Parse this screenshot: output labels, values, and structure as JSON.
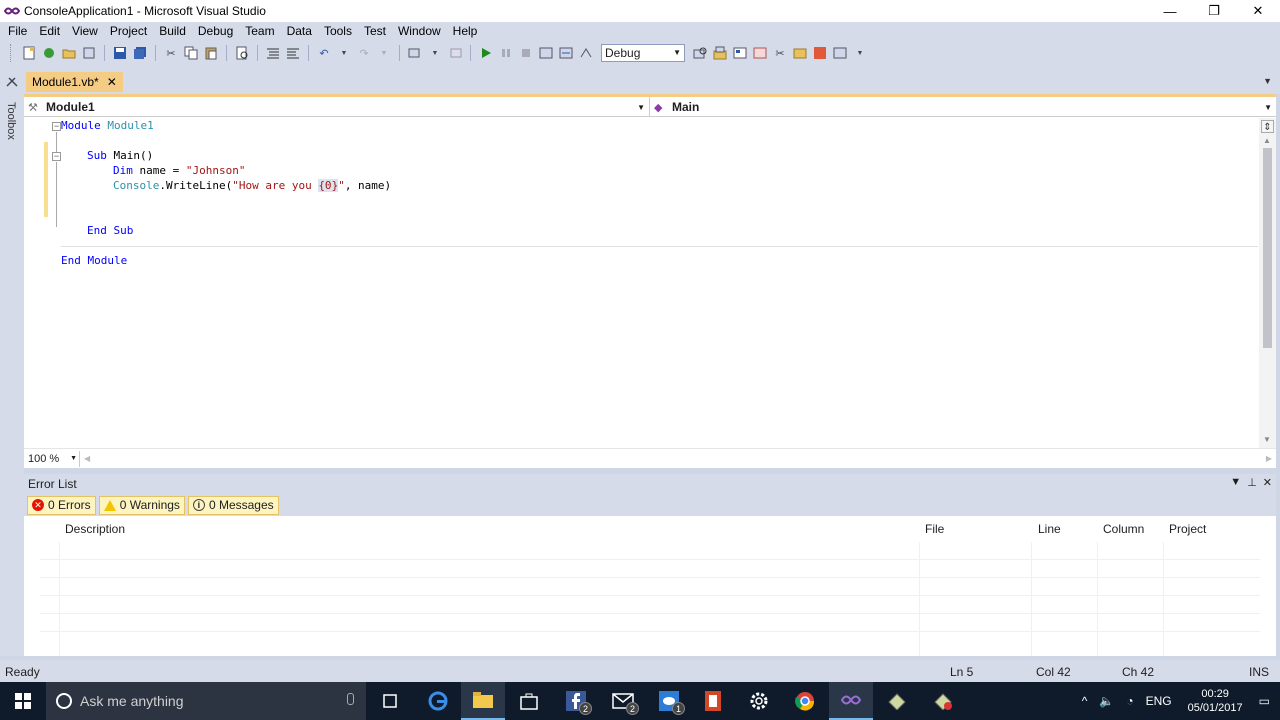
{
  "window": {
    "title": "ConsoleApplication1 - Microsoft Visual Studio",
    "minimize": "—",
    "restore": "❐",
    "close": "✕"
  },
  "menu": [
    "File",
    "Edit",
    "View",
    "Project",
    "Build",
    "Debug",
    "Team",
    "Data",
    "Tools",
    "Test",
    "Window",
    "Help"
  ],
  "toolbar": {
    "config_value": "Debug"
  },
  "toolbox": {
    "label": "Toolbox"
  },
  "document_tab": {
    "label": "Module1.vb*",
    "close": "✕"
  },
  "navbar": {
    "left": "Module1",
    "right": "Main"
  },
  "code": {
    "l1_kw": "Module",
    "l1_name": "Module1",
    "l3_kw": "Sub",
    "l3_rest": "Main()",
    "l4_kw": "Dim",
    "l4_rest": "name = ",
    "l4_str": "\"Johnson\"",
    "l5_type": "Console",
    "l5_rest": ".WriteLine(",
    "l5_str1": "\"How are you ",
    "l5_str_hl": "{0",
    "l5_caret": "}",
    "l5_str2": "\"",
    "l5_end": ", name)",
    "l8_kw": "End Sub",
    "l10_kw": "End Module"
  },
  "zoom": {
    "value": "100 %"
  },
  "error_list": {
    "title": "Error List",
    "errors": "0 Errors",
    "warnings": "0 Warnings",
    "messages": "0 Messages",
    "columns": [
      "Description",
      "File",
      "Line",
      "Column",
      "Project"
    ]
  },
  "status": {
    "ready": "Ready",
    "ln": "Ln 5",
    "col": "Col 42",
    "ch": "Ch 42",
    "ins": "INS"
  },
  "taskbar": {
    "search_placeholder": "Ask me anything",
    "clock_time": "00:29",
    "clock_date": "05/01/2017",
    "language": "ENG",
    "badge_facebook": "2",
    "badge_mail": "2",
    "badge_messenger": "1"
  },
  "colors": {
    "accent_tab": "#f5cc84",
    "chrome": "#d6dbe9",
    "taskbar": "#0f1b2b",
    "keyword": "#0000ff",
    "type": "#2b91af",
    "string": "#a31515"
  },
  "icons": [
    "vs-logo-icon",
    "new-project-icon",
    "open-icon",
    "save-icon",
    "save-all-icon",
    "cut-icon",
    "copy-icon",
    "paste-icon",
    "undo-icon",
    "redo-icon",
    "start-icon",
    "pause-icon",
    "stop-icon",
    "search-icon",
    "windows-start-icon",
    "edge-icon",
    "explorer-icon",
    "store-icon",
    "facebook-icon",
    "mail-icon",
    "messenger-icon",
    "office-icon",
    "settings-icon",
    "chrome-icon",
    "visual-studio-icon"
  ]
}
